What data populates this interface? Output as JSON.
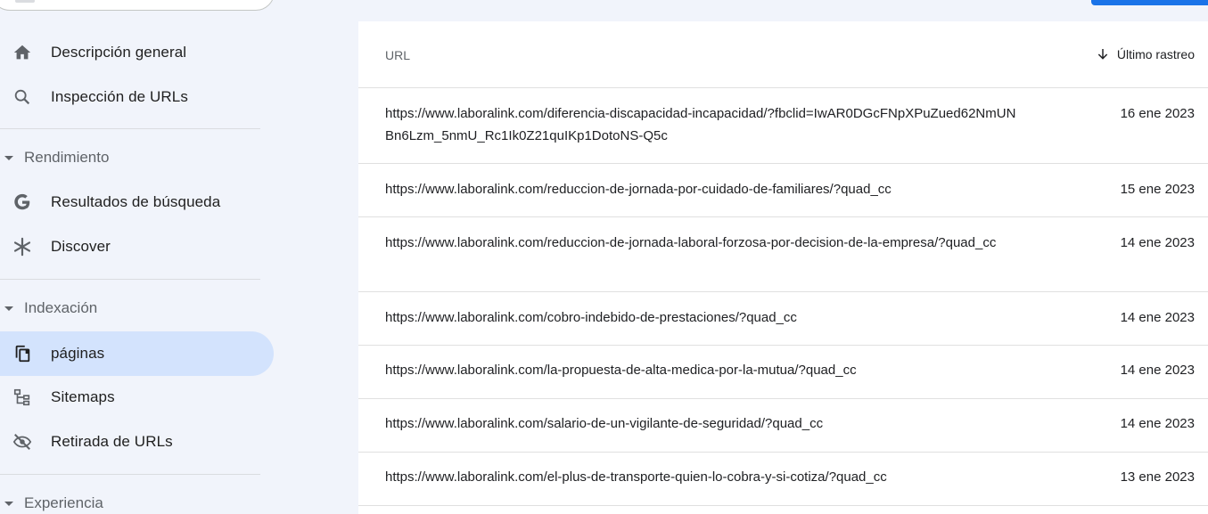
{
  "sidebar": {
    "nav_top": [
      {
        "label": "Descripción general",
        "icon": "home-icon"
      },
      {
        "label": "Inspección de URLs",
        "icon": "search-icon"
      }
    ],
    "sections": [
      {
        "title": "Rendimiento",
        "items": [
          {
            "label": "Resultados de búsqueda",
            "icon": "google-g-icon"
          },
          {
            "label": "Discover",
            "icon": "asterisk-icon"
          }
        ]
      },
      {
        "title": "Indexación",
        "items": [
          {
            "label": "páginas",
            "icon": "pages-copy-icon",
            "active": true
          },
          {
            "label": "Sitemaps",
            "icon": "sitemap-icon"
          },
          {
            "label": "Retirada de URLs",
            "icon": "eye-off-icon"
          }
        ]
      },
      {
        "title": "Experiencia",
        "items": []
      }
    ]
  },
  "table": {
    "header_url": "URL",
    "header_date": "Último rastreo",
    "rows": [
      {
        "url": "https://www.laboralink.com/diferencia-discapacidad-incapacidad/?fbclid=IwAR0DGcFNpXPuZued62NmUNBn6Lzm_5nmU_Rc1Ik0Z21quIKp1DotoNS-Q5c",
        "date": "16 ene 2023"
      },
      {
        "url": "https://www.laboralink.com/reduccion-de-jornada-por-cuidado-de-familiares/?quad_cc",
        "date": "15 ene 2023"
      },
      {
        "url": "https://www.laboralink.com/reduccion-de-jornada-laboral-forzosa-por-decision-de-la-empresa/?quad_cc",
        "date": "14 ene 2023"
      },
      {
        "url": "https://www.laboralink.com/cobro-indebido-de-prestaciones/?quad_cc",
        "date": "14 ene 2023"
      },
      {
        "url": "https://www.laboralink.com/la-propuesta-de-alta-medica-por-la-mutua/?quad_cc",
        "date": "14 ene 2023"
      },
      {
        "url": "https://www.laboralink.com/salario-de-un-vigilante-de-seguridad/?quad_cc",
        "date": "14 ene 2023"
      },
      {
        "url": "https://www.laboralink.com/el-plus-de-transporte-quien-lo-cobra-y-si-cotiza/?quad_cc",
        "date": "13 ene 2023"
      }
    ]
  },
  "colors": {
    "sidebar_bg": "#f1f4fb",
    "active_bg": "#d3e3fd",
    "accent": "#1a73e8"
  }
}
